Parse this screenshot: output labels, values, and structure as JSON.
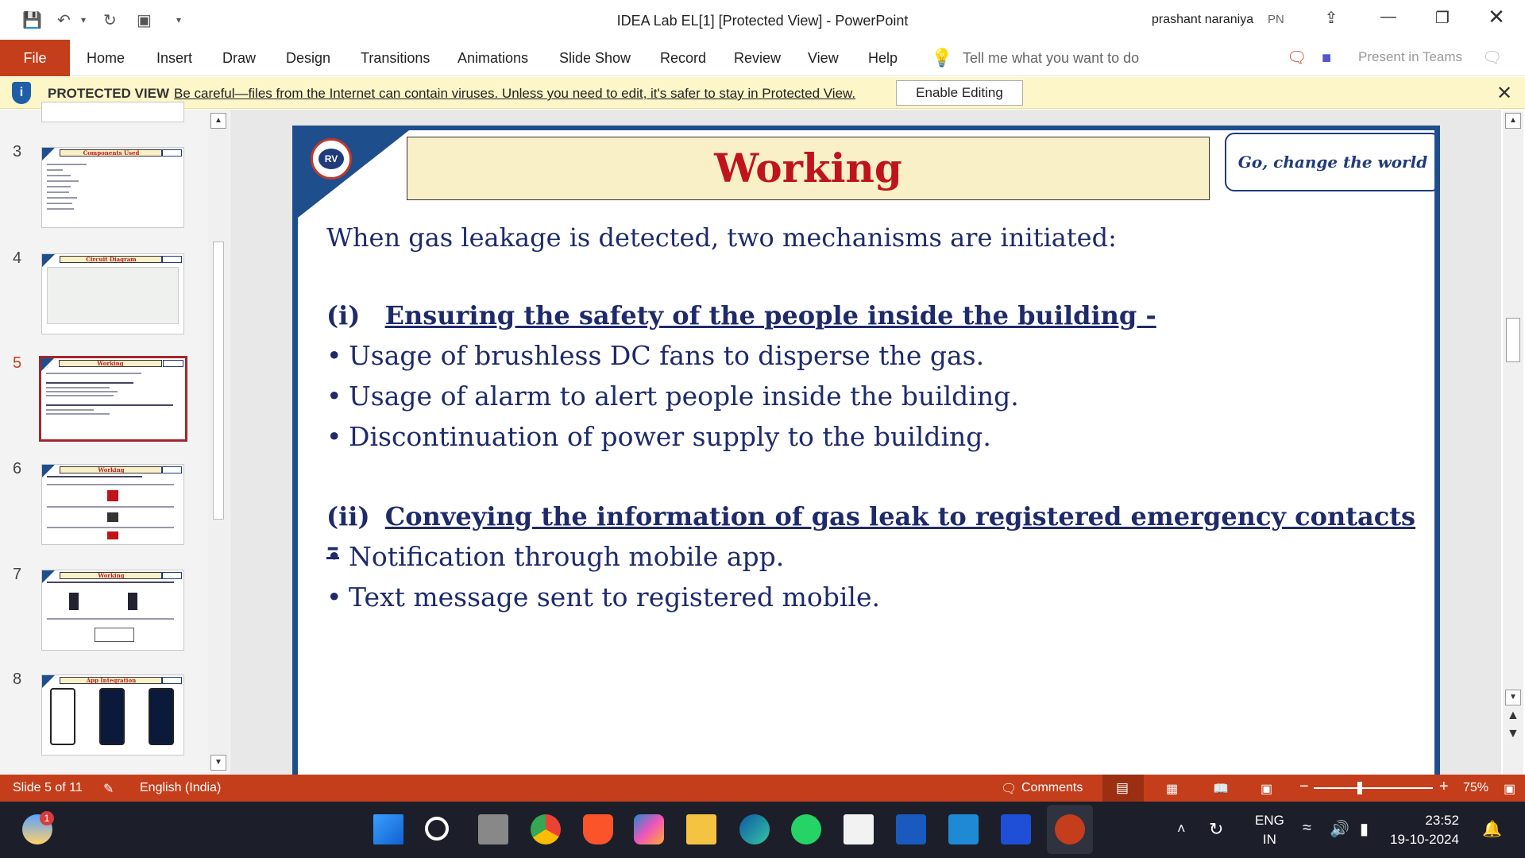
{
  "window": {
    "title": "IDEA Lab EL[1] [Protected View]  -  PowerPoint",
    "user_name": "prashant naraniya",
    "user_initials": "PN"
  },
  "ribbon": {
    "file_label": "File",
    "tabs": [
      "Home",
      "Insert",
      "Draw",
      "Design",
      "Transitions",
      "Animations",
      "Slide Show",
      "Record",
      "Review",
      "View",
      "Help"
    ],
    "tell_me": "Tell me what you want to do",
    "present_teams": "Present in Teams"
  },
  "protected_view": {
    "label": "PROTECTED VIEW",
    "message": "Be careful—files from the Internet can contain viruses. Unless you need to edit, it's safer to stay in Protected View.",
    "enable_button": "Enable Editing"
  },
  "thumbnails": {
    "selected_index": 2,
    "items": [
      {
        "number": "3",
        "title": "Components Used"
      },
      {
        "number": "4",
        "title": "Circuit Diagram"
      },
      {
        "number": "5",
        "title": "Working"
      },
      {
        "number": "6",
        "title": "Working"
      },
      {
        "number": "7",
        "title": "Working"
      },
      {
        "number": "8",
        "title": "App Integration"
      }
    ]
  },
  "slide": {
    "title": "Working",
    "tagline": "Go, change the world",
    "logo_text": "RV",
    "intro": "When gas leakage is detected, two mechanisms are initiated:",
    "section1_num": "(i)",
    "section1_heading": "Ensuring the safety of the people inside the building -",
    "section1_bullets": [
      "Usage of brushless DC fans to disperse the gas.",
      "Usage of alarm to alert people inside the building.",
      "Discontinuation of power supply to the building."
    ],
    "section2_num": "(ii)",
    "section2_heading": "Conveying the information of gas leak to registered emergency contacts –",
    "section2_bullets": [
      "Notification through mobile app.",
      "Text message sent to registered mobile."
    ]
  },
  "status_bar": {
    "slide_indicator": "Slide 5 of 11",
    "language": "English (India)",
    "comments": "Comments",
    "zoom": "75%",
    "zoom_level_percent": 75
  },
  "taskbar": {
    "weather_badge": "1",
    "lang_top": "ENG",
    "lang_bottom": "IN",
    "time": "23:52",
    "date": "19-10-2024"
  }
}
